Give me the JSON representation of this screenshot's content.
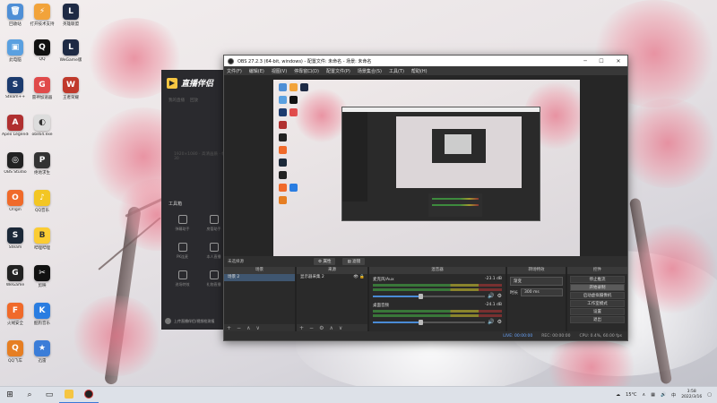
{
  "desktop": {
    "icons": [
      {
        "label": "回收站",
        "color": "#4f8fd6",
        "glyph": "🗑"
      },
      {
        "label": "打开技术支持",
        "color": "#f2a33a",
        "glyph": "⚡"
      },
      {
        "label": "英雄联盟",
        "color": "#1e2a44",
        "glyph": "L"
      },
      {
        "label": "此电脑",
        "color": "#5aa0e0",
        "glyph": "▣"
      },
      {
        "label": "QQ",
        "color": "#111",
        "glyph": "Q"
      },
      {
        "label": "WeGame版",
        "color": "#1e2a44",
        "glyph": "L"
      },
      {
        "label": "Steam++",
        "color": "#1c3b6e",
        "glyph": "S"
      },
      {
        "label": "雷神加速器",
        "color": "#e04a4a",
        "glyph": "G"
      },
      {
        "label": "王者荣耀",
        "color": "#c0392b",
        "glyph": "W"
      },
      {
        "label": "Apex Legends",
        "color": "#b03030",
        "glyph": "A"
      },
      {
        "label": "obs64.exe",
        "color": "#ddd",
        "glyph": "◐"
      },
      {
        "label": "OBS Studio",
        "color": "#222",
        "glyph": "◎"
      },
      {
        "label": "绝地求生",
        "color": "#333",
        "glyph": "P"
      },
      {
        "label": "Origin",
        "color": "#f06a2a",
        "glyph": "O"
      },
      {
        "label": "QQ音乐",
        "color": "#f3c623",
        "glyph": "♪"
      },
      {
        "label": "Steam",
        "color": "#1b2838",
        "glyph": "S"
      },
      {
        "label": "哔哩哔哩",
        "color": "#fbcc33",
        "glyph": "B"
      },
      {
        "label": "WeGame",
        "color": "#222",
        "glyph": "G"
      },
      {
        "label": "剪映",
        "color": "#111",
        "glyph": "✂"
      },
      {
        "label": "火绒安全",
        "color": "#f06a2a",
        "glyph": "F"
      },
      {
        "label": "酷狗音乐",
        "color": "#2a7de1",
        "glyph": "K"
      },
      {
        "label": "QQ飞车",
        "color": "#e67e22",
        "glyph": "Q"
      },
      {
        "label": "迅雷",
        "color": "#3b7dd8",
        "glyph": "★"
      }
    ]
  },
  "companion": {
    "title": "直播伴侣",
    "tabs": [
      "我的直播",
      "回放"
    ],
    "hint": "1920×1080 · 高清画质 · 帧率30",
    "toolbox_label": "工具箱",
    "tools": [
      "弹幕助手",
      "房管助手",
      "PK连麦",
      "本人直播",
      "进场特效",
      "礼物直播"
    ],
    "footer": "上传直播伴侣/视频检测报"
  },
  "obs": {
    "title": "OBS 27.2.3 (64-bit, windows) - 配置文件: 未命名 - 场景: 未命名",
    "menu": [
      "文件(F)",
      "编辑(E)",
      "视图(V)",
      "停靠窗口(D)",
      "配置文件(P)",
      "场景集合(S)",
      "工具(T)",
      "帮助(H)"
    ],
    "source_hint": "未选择源",
    "toolbar": {
      "properties": "属性",
      "filters": "滤镜"
    },
    "docks": {
      "scenes": {
        "title": "场景",
        "items": [
          "场景 2"
        ]
      },
      "sources": {
        "title": "来源",
        "items": [
          "显示器采集 2"
        ]
      },
      "mixer": {
        "title": "混音器",
        "channels": [
          {
            "name": "麦克风/Aux",
            "db": "-23.1 dB",
            "volume": 0.42
          },
          {
            "name": "桌面音频",
            "db": "-24.1 dB",
            "volume": 0.42
          }
        ]
      },
      "transitions": {
        "title": "转场特效",
        "mode": "渐变",
        "duration_label": "时长",
        "duration": "300 ms"
      },
      "controls": {
        "title": "控件",
        "buttons": [
          "停止推流",
          "开始录制",
          "启动虚拟摄像机",
          "工作室模式",
          "设置",
          "退出"
        ]
      }
    },
    "status": {
      "live": "LIVE: 00:00:00",
      "rec": "REC: 00:00:00",
      "cpu": "CPU: 0.4%, 60.00 fps"
    }
  },
  "taskbar": {
    "weather": "15°C",
    "language": "中",
    "time": "3:58",
    "date": "2022/3/16"
  }
}
